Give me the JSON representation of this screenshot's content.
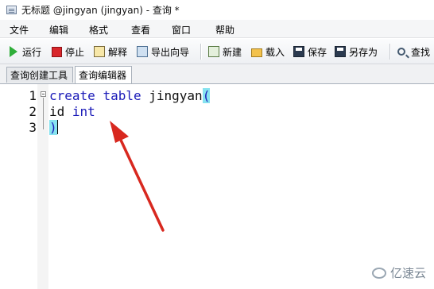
{
  "window": {
    "title": "无标题 @jingyan (jingyan) - 查询 *"
  },
  "menu": {
    "items": [
      "文件",
      "编辑",
      "格式",
      "查看",
      "窗口",
      "帮助"
    ]
  },
  "toolbar": {
    "run": "运行",
    "stop": "停止",
    "explain": "解释",
    "export_wizard": "导出向导",
    "new": "新建",
    "load": "载入",
    "save": "保存",
    "save_as": "另存为",
    "find": "查找"
  },
  "tabs": {
    "items": [
      "查询创建工具",
      "查询编辑器"
    ],
    "active": "查询编辑器"
  },
  "editor": {
    "line_numbers": [
      "1",
      "2",
      "3"
    ],
    "lines": [
      {
        "kw1": "create",
        "kw2": "table",
        "name": "jingyan",
        "open": "("
      },
      {
        "col": "id",
        "type": "int"
      },
      {
        "close": ")"
      }
    ]
  },
  "colors": {
    "keyword": "#1a1ab8",
    "paren_highlight": "#87e3f0",
    "arrow": "#d8281f"
  },
  "watermark": {
    "text": "亿速云"
  }
}
